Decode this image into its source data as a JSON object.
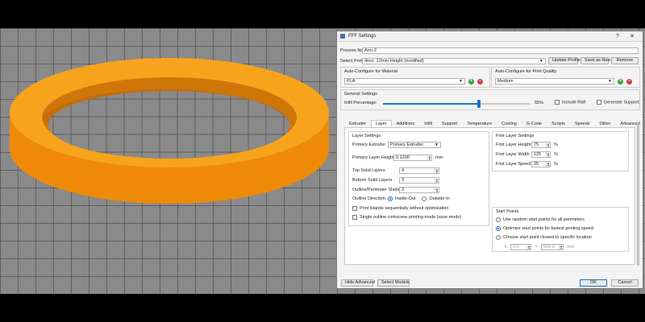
{
  "dialog": {
    "title": "FFF Settings",
    "help_glyph": "?",
    "close_glyph": "✕",
    "process_name_label": "Process Name:",
    "process_name_value": "Arm-2",
    "select_profile_label": "Select Profile:",
    "select_profile_value": "4noz .12mm Height (modified)",
    "update_profile": "Update Profile",
    "save_as_new": "Save as New",
    "remove": "Remove"
  },
  "autoconfig": {
    "material_label": "Auto-Configure for Material",
    "material_value": "PLA",
    "quality_label": "Auto-Configure for Print Quality",
    "quality_value": "Medium"
  },
  "general": {
    "label": "General Settings",
    "infill_label": "Infill Percentage:",
    "infill_value": "65%",
    "infill_fraction": 0.65,
    "include_raft": "Include Raft",
    "generate_support": "Generate Support"
  },
  "tabs": [
    "Extruder",
    "Layer",
    "Additions",
    "Infill",
    "Support",
    "Temperature",
    "Cooling",
    "G-Code",
    "Scripts",
    "Speeds",
    "Other",
    "Advanced"
  ],
  "active_tab": "Layer",
  "layer_settings": {
    "title": "Layer Settings",
    "primary_extruder_label": "Primary Extruder",
    "primary_extruder_value": "Primary Extruder",
    "primary_layer_height_label": "Primary Layer Height",
    "primary_layer_height_value": "0.1200",
    "primary_layer_height_unit": "mm",
    "top_solid_label": "Top Solid Layers",
    "top_solid_value": "4",
    "bottom_solid_label": "Bottom Solid Layers",
    "bottom_solid_value": "3",
    "outline_shells_label": "Outline/Perimeter Shells",
    "outline_shells_value": "3",
    "outline_direction_label": "Outline Direction:",
    "inside_out": "Inside-Out",
    "outside_in": "Outside-In",
    "print_islands": "Print islands sequentially without optimization",
    "single_outline": "Single outline corkscrew printing mode (vase mode)"
  },
  "first_layer": {
    "title": "First Layer Settings",
    "height_label": "First Layer Height",
    "height_value": "75",
    "width_label": "First Layer Width",
    "width_value": "125",
    "speed_label": "First Layer Speed",
    "speed_value": "25",
    "unit": "%"
  },
  "start_points": {
    "title": "Start Points",
    "random": "Use random start points for all perimeters",
    "optimize": "Optimize start points for fastest printing speed",
    "closest": "Choose start point closest to specific location",
    "x_label": "X:",
    "x_value": "0.0",
    "y_label": "Y:",
    "y_value": "500.0",
    "unit": "mm"
  },
  "footer": {
    "hide_advanced": "Hide Advanced",
    "select_models": "Select Models",
    "ok": "OK",
    "cancel": "Cancel"
  },
  "colors": {
    "ring_top": "#f7a11a",
    "ring_side": "#f08a08",
    "ring_inner": "#c96f0a",
    "accent": "#1e73c8"
  }
}
